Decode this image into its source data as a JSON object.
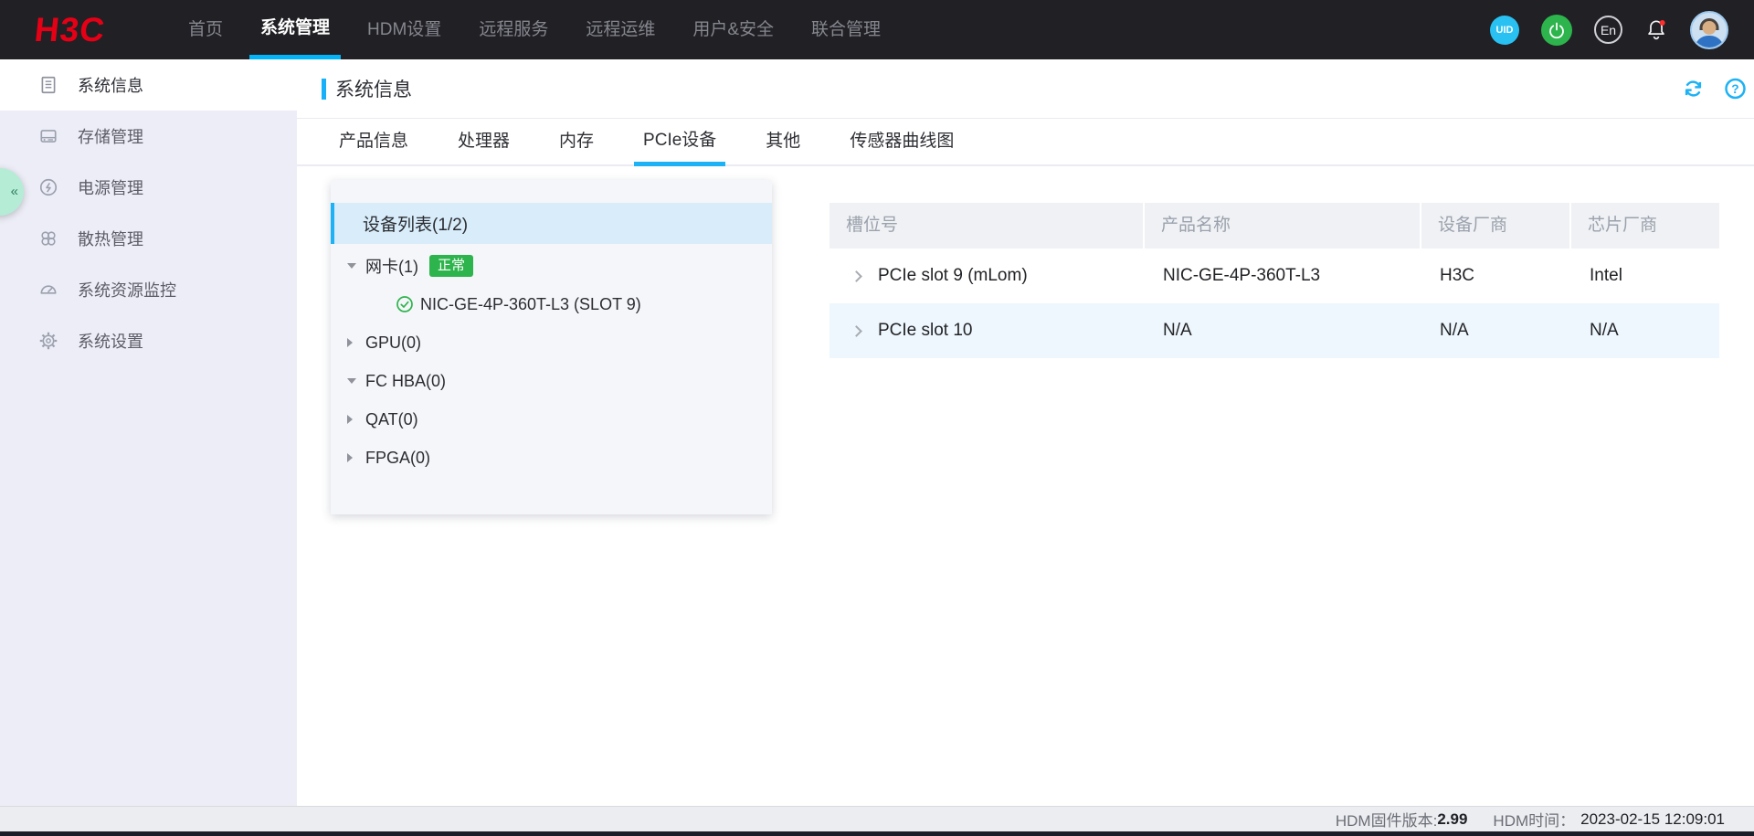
{
  "navbar": {
    "logo": "H3C",
    "items": [
      {
        "label": "首页",
        "active": false
      },
      {
        "label": "系统管理",
        "active": true
      },
      {
        "label": "HDM设置",
        "active": false
      },
      {
        "label": "远程服务",
        "active": false
      },
      {
        "label": "远程运维",
        "active": false
      },
      {
        "label": "用户&安全",
        "active": false
      },
      {
        "label": "联合管理",
        "active": false
      }
    ],
    "uid_label": "UID",
    "lang_label": "En",
    "icons": [
      "uid-badge",
      "power-icon",
      "language-icon",
      "bell-icon",
      "avatar"
    ]
  },
  "sidebar": {
    "items": [
      {
        "label": "系统信息",
        "icon": "document-icon",
        "active": true
      },
      {
        "label": "存储管理",
        "icon": "storage-icon",
        "active": false
      },
      {
        "label": "电源管理",
        "icon": "power-circle-icon",
        "active": false
      },
      {
        "label": "散热管理",
        "icon": "fan-icon",
        "active": false
      },
      {
        "label": "系统资源监控",
        "icon": "gauge-icon",
        "active": false
      },
      {
        "label": "系统设置",
        "icon": "gear-icon",
        "active": false
      }
    ]
  },
  "page": {
    "title": "系统信息",
    "header_icons": [
      "refresh-icon",
      "help-icon"
    ],
    "tabs": [
      {
        "label": "产品信息",
        "active": false
      },
      {
        "label": "处理器",
        "active": false
      },
      {
        "label": "内存",
        "active": false
      },
      {
        "label": "PCIe设备",
        "active": true
      },
      {
        "label": "其他",
        "active": false
      },
      {
        "label": "传感器曲线图",
        "active": false
      }
    ]
  },
  "device_panel": {
    "header": "设备列表(1/2)",
    "tree": [
      {
        "label": "网卡(1)",
        "expanded": true,
        "badge": "正常"
      },
      {
        "label": "NIC-GE-4P-360T-L3 (SLOT 9)",
        "child": true,
        "status_icon": "check-circle-icon"
      },
      {
        "label": "GPU(0)",
        "expanded": false
      },
      {
        "label": "FC HBA(0)",
        "expanded": true
      },
      {
        "label": "QAT(0)",
        "expanded": false
      },
      {
        "label": "FPGA(0)",
        "expanded": false
      }
    ]
  },
  "table": {
    "columns": [
      "槽位号",
      "产品名称",
      "设备厂商",
      "芯片厂商"
    ],
    "rows": [
      {
        "slot": "PCIe slot 9 (mLom)",
        "product": "NIC-GE-4P-360T-L3",
        "vendor": "H3C",
        "chip": "Intel"
      },
      {
        "slot": "PCIe slot 10",
        "product": "N/A",
        "vendor": "N/A",
        "chip": "N/A"
      }
    ]
  },
  "footer": {
    "firmware_label": "HDM固件版本:",
    "firmware_value": "2.99",
    "time_label": "HDM时间：",
    "time_value": "2023-02-15 12:09:01"
  },
  "colors": {
    "accent": "#18b0f8",
    "nav_bg": "#202025",
    "green": "#2db44c",
    "logo_red": "#e60016",
    "selected_row": "#d8ecfa"
  }
}
